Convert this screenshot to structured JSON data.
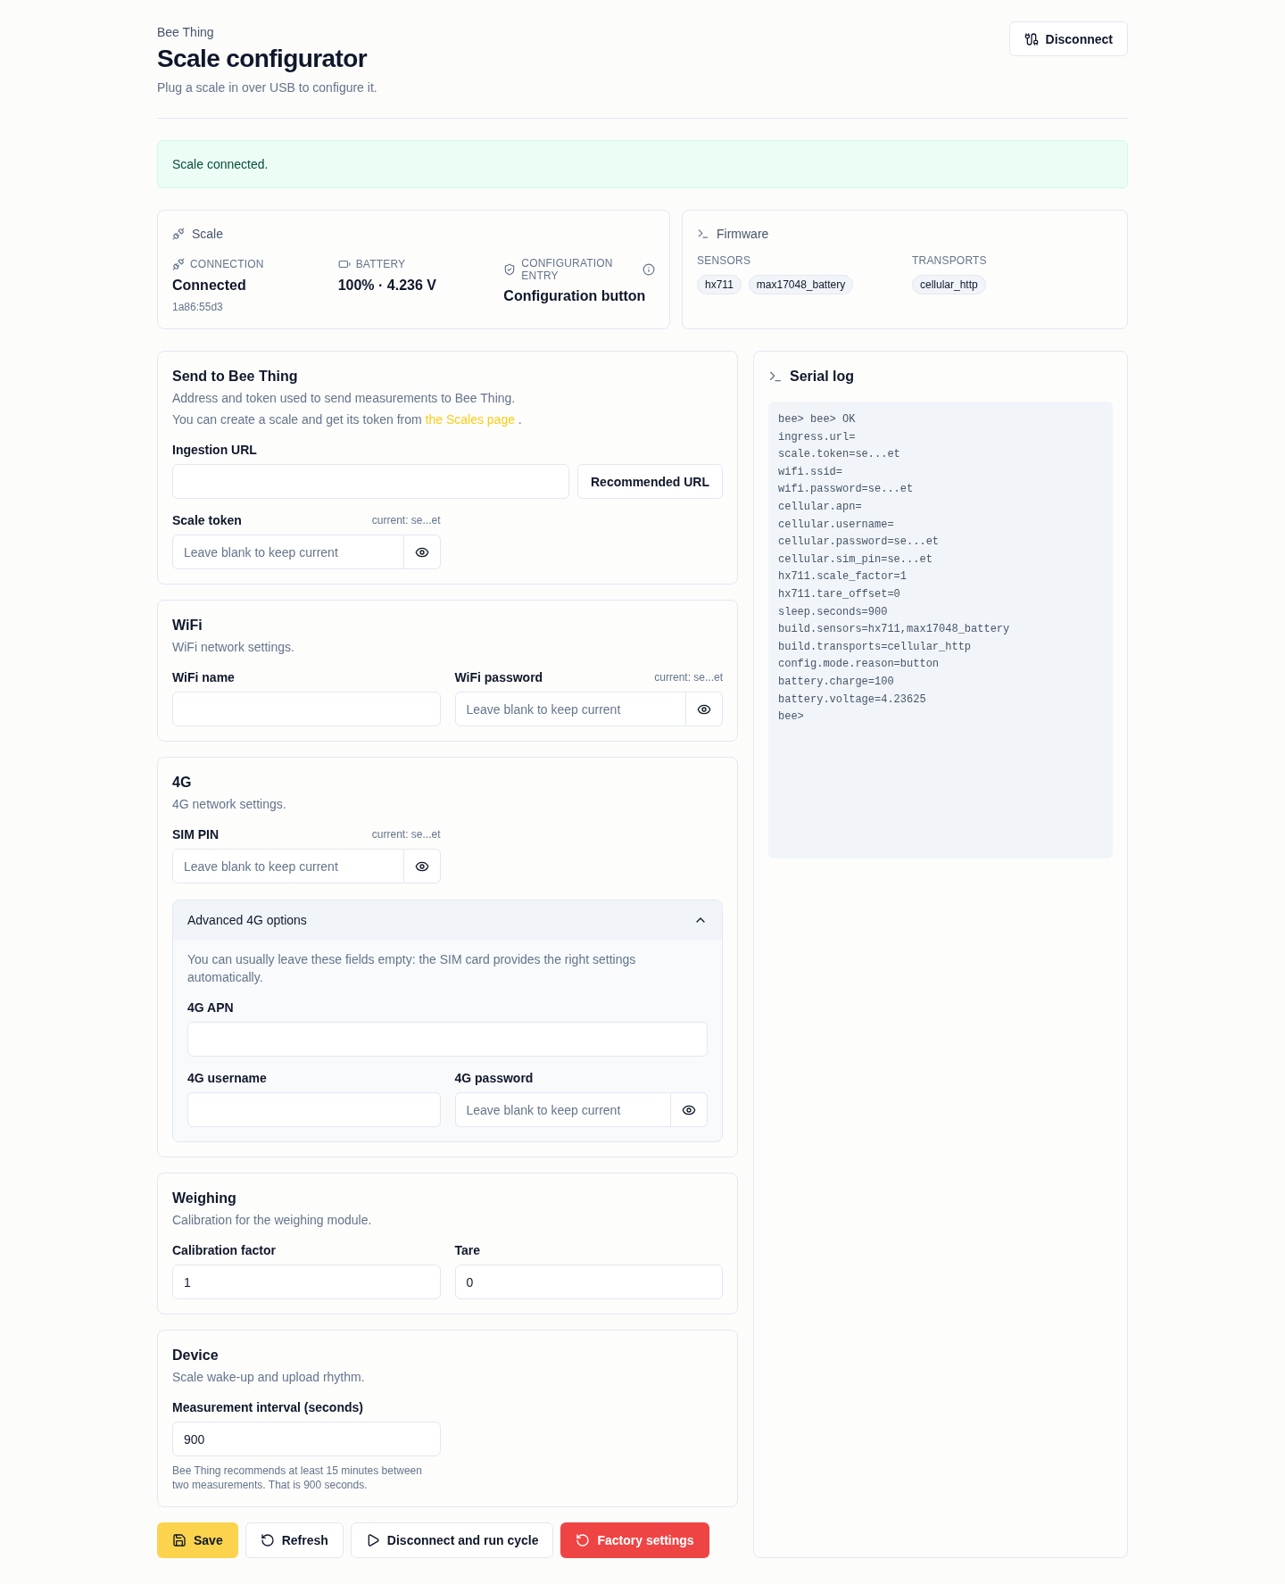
{
  "header": {
    "eyebrow": "Bee Thing",
    "title": "Scale configurator",
    "subtitle": "Plug a scale in over USB to configure it.",
    "button": "Disconnect"
  },
  "alert": {
    "kind": "success",
    "text": "Scale connected."
  },
  "scale_card": {
    "title": "Scale",
    "fields": [
      {
        "kind": "connection",
        "label": "CONNECTION",
        "value": "Connected",
        "detail": "1a86:55d3"
      },
      {
        "kind": "battery",
        "label": "BATTERY",
        "value": "100% · 4.236 V"
      },
      {
        "kind": "config",
        "label": "CONFIGURATION ENTRY",
        "value": "Configuration button"
      }
    ]
  },
  "firmware_card": {
    "title": "Firmware",
    "groups": [
      {
        "label": "SENSORS",
        "tags": [
          "hx711",
          "max17048_battery"
        ]
      },
      {
        "label": "TRANSPORTS",
        "tags": [
          "cellular_http"
        ]
      }
    ]
  },
  "sections": [
    {
      "title": "Send to Bee Thing",
      "paragraphs": [
        {
          "text": "Address and token used to send measurements to Bee Thing."
        },
        {
          "text": "You can create a scale and get its token from",
          "link": "the Scales page",
          "tail": "."
        }
      ],
      "rows": [
        [
          {
            "kind": "url",
            "label": "Ingestion URL",
            "button": "Recommended URL"
          }
        ],
        [
          {
            "kind": "secret",
            "label": "Scale token",
            "current": "current: se...et",
            "placeholder": "Leave blank to keep current"
          }
        ]
      ]
    },
    {
      "title": "WiFi",
      "paragraphs": [
        {
          "text": "WiFi network settings."
        }
      ],
      "rows": [
        [
          {
            "kind": "text",
            "label": "WiFi name"
          },
          {
            "kind": "secret",
            "label": "WiFi password",
            "current": "current: se...et",
            "placeholder": "Leave blank to keep current"
          }
        ]
      ]
    },
    {
      "title": "4G",
      "paragraphs": [
        {
          "text": "4G network settings."
        }
      ],
      "rows": [
        [
          {
            "kind": "secret",
            "label": "SIM PIN",
            "current": "current: se...et",
            "placeholder": "Leave blank to keep current"
          }
        ]
      ],
      "advanced": {
        "title": "Advanced 4G options",
        "expanded": true,
        "note": "You can usually leave these fields empty: the SIM card provides the right settings automatically.",
        "rows": [
          [
            {
              "kind": "text",
              "label": "4G APN"
            }
          ],
          [
            {
              "kind": "text",
              "label": "4G username"
            },
            {
              "kind": "secret",
              "label": "4G password",
              "placeholder": "Leave blank to keep current"
            }
          ]
        ]
      }
    },
    {
      "title": "Weighing",
      "paragraphs": [
        {
          "text": "Calibration for the weighing module."
        }
      ],
      "rows": [
        [
          {
            "kind": "text",
            "label": "Calibration factor",
            "value": "1"
          },
          {
            "kind": "text",
            "label": "Tare",
            "value": "0"
          }
        ]
      ]
    },
    {
      "title": "Device",
      "paragraphs": [
        {
          "text": "Scale wake-up and upload rhythm."
        }
      ],
      "rows": [
        [
          {
            "kind": "text",
            "label": "Measurement interval (seconds)",
            "value": "900",
            "help": "Bee Thing recommends at least 15 minutes between two measurements. That is 900 seconds."
          }
        ]
      ]
    }
  ],
  "actions": [
    {
      "kind": "save",
      "label": "Save"
    },
    {
      "kind": "refresh",
      "label": "Refresh"
    },
    {
      "kind": "run",
      "label": "Disconnect and run cycle"
    },
    {
      "kind": "reset",
      "label": "Factory settings"
    }
  ],
  "serial_log": {
    "title": "Serial log",
    "lines": [
      "bee> bee> OK",
      "ingress.url=",
      "scale.token=se...et",
      "wifi.ssid=",
      "wifi.password=se...et",
      "cellular.apn=",
      "cellular.username=",
      "cellular.password=se...et",
      "cellular.sim_pin=se...et",
      "hx711.scale_factor=1",
      "hx711.tare_offset=0",
      "sleep.seconds=900",
      "build.sensors=hx711,max17048_battery",
      "build.transports=cellular_http",
      "config.mode.reason=button",
      "battery.charge=100",
      "battery.voltage=4.23625",
      "bee>"
    ]
  }
}
